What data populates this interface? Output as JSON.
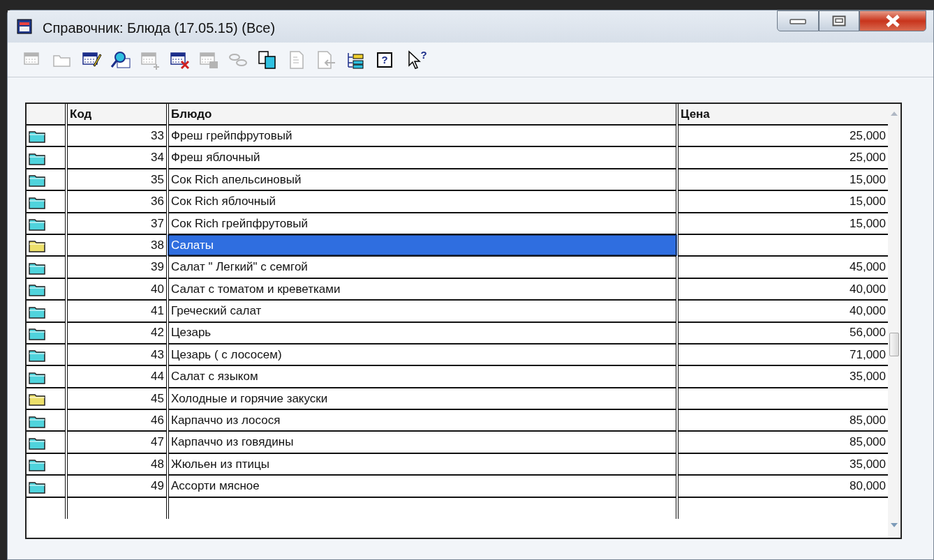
{
  "window": {
    "title": "Справочник: Блюда (17.05.15) (Все)"
  },
  "toolbar": [
    {
      "kind": "table",
      "disabled": true
    },
    {
      "kind": "folder",
      "disabled": true
    },
    {
      "kind": "edit",
      "disabled": false
    },
    {
      "kind": "search",
      "disabled": false
    },
    {
      "kind": "add",
      "disabled": true
    },
    {
      "kind": "delete",
      "disabled": false
    },
    {
      "kind": "view",
      "disabled": true
    },
    {
      "kind": "link",
      "disabled": true
    },
    {
      "kind": "copy",
      "disabled": false
    },
    {
      "kind": "document",
      "disabled": true
    },
    {
      "kind": "import",
      "disabled": true
    },
    {
      "kind": "tree",
      "disabled": false
    },
    {
      "kind": "help",
      "glyph": "?",
      "disabled": false
    },
    {
      "kind": "pointer-help",
      "glyph": "?",
      "disabled": false
    }
  ],
  "table": {
    "columns": [
      "Код",
      "Блюдо",
      "Цена"
    ],
    "rows": [
      {
        "kind": "item",
        "code": "33",
        "name": "Фреш грейпфрутовый",
        "price": "25,000",
        "selected": false
      },
      {
        "kind": "item",
        "code": "34",
        "name": "Фреш яблочный",
        "price": "25,000",
        "selected": false
      },
      {
        "kind": "item",
        "code": "35",
        "name": "Сок Rich апельсиновый",
        "price": "15,000",
        "selected": false
      },
      {
        "kind": "item",
        "code": "36",
        "name": "Сок Rich яблочный",
        "price": "15,000",
        "selected": false
      },
      {
        "kind": "item",
        "code": "37",
        "name": "Сок Rich грейпфрутовый",
        "price": "15,000",
        "selected": false
      },
      {
        "kind": "group",
        "code": "38",
        "name": "Салаты",
        "selected": true
      },
      {
        "kind": "item",
        "code": "39",
        "name": "Салат \" Легкий\" с семгой",
        "price": "45,000",
        "selected": false
      },
      {
        "kind": "item",
        "code": "40",
        "name": "Салат с томатом и креветками",
        "price": "40,000",
        "selected": false
      },
      {
        "kind": "item",
        "code": "41",
        "name": "Греческий салат",
        "price": "40,000",
        "selected": false
      },
      {
        "kind": "item",
        "code": "42",
        "name": "Цезарь",
        "price": "56,000",
        "selected": false
      },
      {
        "kind": "item",
        "code": "43",
        "name": "Цезарь ( с лососем)",
        "price": "71,000",
        "selected": false
      },
      {
        "kind": "item",
        "code": "44",
        "name": "Салат с языком",
        "price": "35,000",
        "selected": false
      },
      {
        "kind": "group",
        "code": "45",
        "name": "Холодные и горячие закуски",
        "selected": false
      },
      {
        "kind": "item",
        "code": "46",
        "name": "Карпаччо из лосося",
        "price": "85,000",
        "selected": false
      },
      {
        "kind": "item",
        "code": "47",
        "name": "Карпаччо из говядины",
        "price": "85,000",
        "selected": false
      },
      {
        "kind": "item",
        "code": "48",
        "name": "Жюльен из птицы",
        "price": "35,000",
        "selected": false
      },
      {
        "kind": "item",
        "code": "49",
        "name": "Ассорти мясное",
        "price": "80,000",
        "selected": false
      }
    ]
  }
}
